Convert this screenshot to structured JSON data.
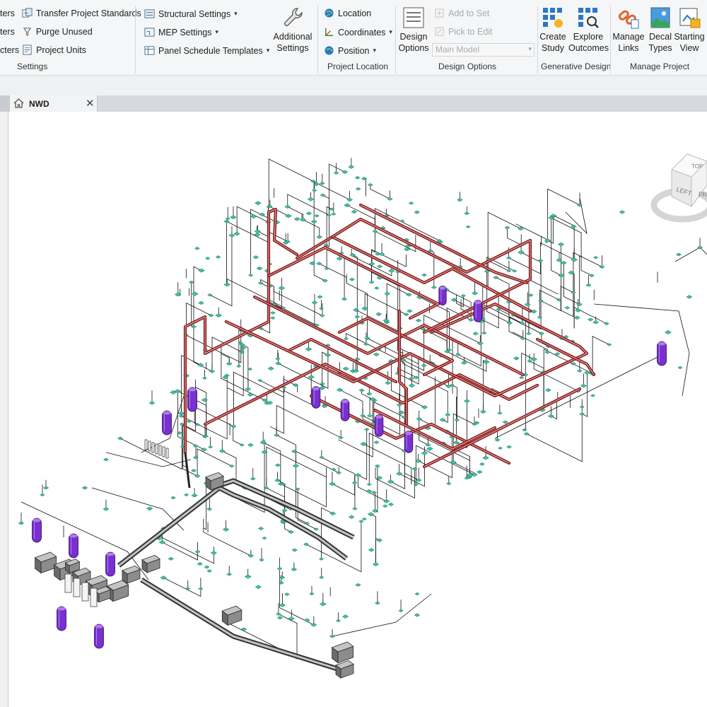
{
  "ribbon": {
    "settings_group": {
      "rows": [
        {
          "left": "ters",
          "right": "Transfer  Project Standards"
        },
        {
          "left": "ters",
          "right": "Purge  Unused"
        },
        {
          "left": "cters",
          "right": "Project  Units"
        }
      ],
      "label": "Settings"
    },
    "mep_group": {
      "structural_settings": "Structural  Settings",
      "mep_settings": "MEP  Settings",
      "panel_schedule_templates": "Panel Schedule  Templates",
      "additional_settings_line1": "Additional",
      "additional_settings_line2": "Settings"
    },
    "project_location": {
      "location": "Location",
      "coordinates": "Coordinates",
      "position": "Position",
      "label": "Project Location"
    },
    "design_options": {
      "button_line1": "Design",
      "button_line2": "Options",
      "add_to_set": "Add to Set",
      "pick_to_edit": "Pick to Edit",
      "select_value": "Main Model",
      "label": "Design Options"
    },
    "generative_design": {
      "create_line1": "Create",
      "create_line2": "Study",
      "explore_line1": "Explore",
      "explore_line2": "Outcomes",
      "label": "Generative Design"
    },
    "manage_project": {
      "manage_links_line1": "Manage",
      "manage_links_line2": "Links",
      "decal_types_line1": "Decal",
      "decal_types_line2": "Types",
      "starting_view_line1": "Starting",
      "starting_view_line2": "View",
      "label": "Manage Project"
    }
  },
  "document_tab": {
    "title": "NWD"
  },
  "viewcube": {
    "top": "TOP",
    "left": "LEFT",
    "front": "FR"
  },
  "colors": {
    "pipe": "#8b1a1a",
    "fixture": "#3fc3a0",
    "tank": "#7a2fd0",
    "wire": "#111111",
    "equipment": "#6e6e6e"
  }
}
